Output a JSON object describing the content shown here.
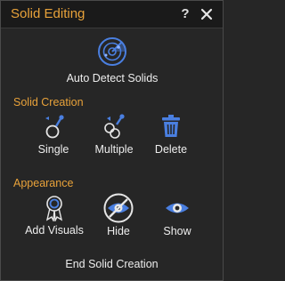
{
  "window": {
    "title": "Solid Editing",
    "help_label": "?",
    "icons": {
      "help": "help-icon",
      "close": "close-icon"
    }
  },
  "auto_detect": {
    "label": "Auto Detect Solids",
    "icon": "radar-icon"
  },
  "solid_creation": {
    "heading": "Solid Creation",
    "buttons": [
      {
        "label": "Single",
        "icon": "single-solid-icon"
      },
      {
        "label": "Multiple",
        "icon": "multiple-solids-icon"
      },
      {
        "label": "Delete",
        "icon": "trash-icon"
      }
    ]
  },
  "appearance": {
    "heading": "Appearance",
    "buttons": [
      {
        "label": "Add Visuals",
        "icon": "ribbon-badge-icon"
      },
      {
        "label": "Hide",
        "icon": "eye-slash-icon",
        "state": "selected"
      },
      {
        "label": "Show",
        "icon": "eye-icon"
      }
    ]
  },
  "footer": {
    "end_label": "End Solid Creation"
  },
  "colors": {
    "accent": "#e8a23a",
    "icon_blue": "#4a7fe0",
    "text": "#ededed",
    "background": "#262626",
    "titlebar": "#1a1a1a"
  }
}
